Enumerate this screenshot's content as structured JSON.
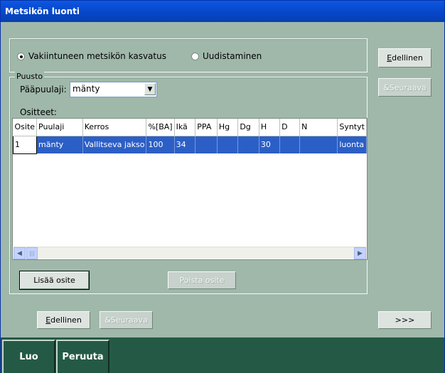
{
  "window": {
    "title": "Metsikön luonti"
  },
  "options": {
    "radio1_label": "Vakiintuneen metsikön kasvatus",
    "radio2_label": "Uudistaminen",
    "radio1_checked": true
  },
  "puusto": {
    "group_label": "Puusto",
    "species_label": "Pääpuulaji:",
    "species_value": "mänty",
    "sections_label": "Ositteet:",
    "columns": [
      "Osite",
      "Puulaji",
      "Kerros",
      "%[BA]",
      "Ikä",
      "PPA",
      "Hg",
      "Dg",
      "H",
      "D",
      "N",
      "Syntyt"
    ],
    "rows": [
      [
        "1",
        "mänty",
        "Vallitseva jakso",
        "100",
        "34",
        "",
        "",
        "",
        "30",
        "",
        "",
        "luonta"
      ]
    ],
    "add_button": "Lisää osite",
    "remove_button": "Poista osite"
  },
  "nav": {
    "prev_label_accel": "E",
    "prev_label_rest": "dellinen",
    "next_label": "&Seuraava",
    "more_label": ">>>"
  },
  "footer": {
    "create": "Luo",
    "cancel": "Peruuta"
  },
  "icons": {
    "scroll_left": "chevron-left-icon",
    "scroll_right": "chevron-right-icon",
    "dropdown": "chevron-down-icon"
  }
}
